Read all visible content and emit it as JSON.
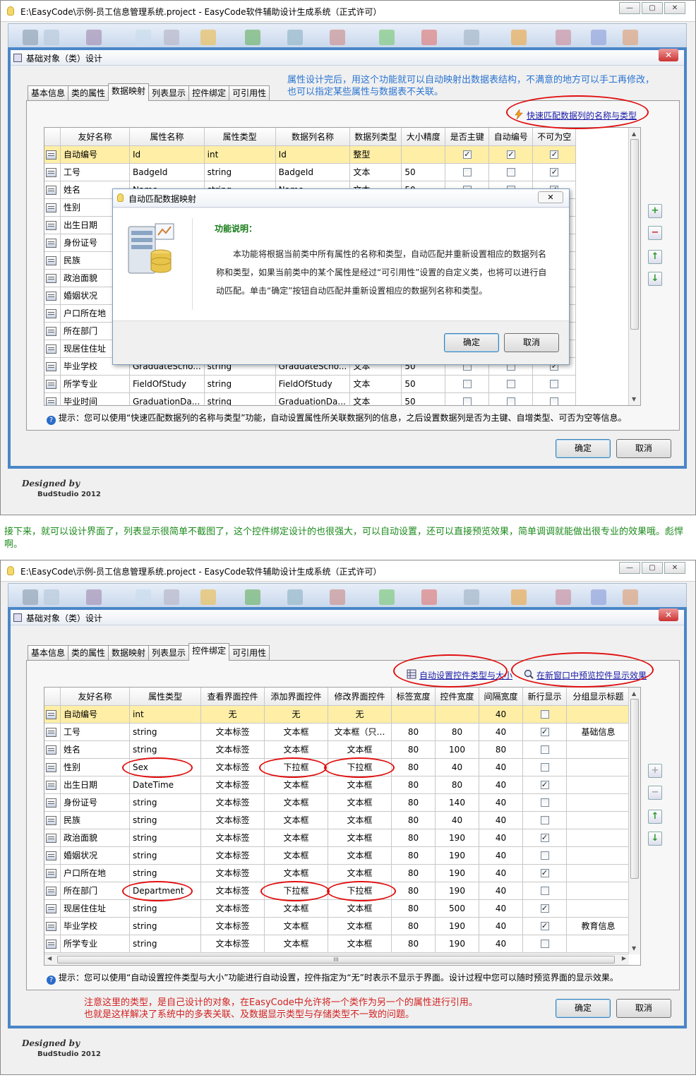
{
  "window_title": "E:\\EasyCode\\示例-员工信息管理系统.project - EasyCode软件辅助设计生成系统（正式许可）",
  "window_buttons": [
    "—",
    "▢",
    "✕"
  ],
  "dialog_title": "基础对象（类）设计",
  "close_glyph": "✕",
  "tabs": [
    "基本信息",
    "类的属性",
    "数据映射",
    "列表显示",
    "控件绑定",
    "可引用性"
  ],
  "ok_label": "确定",
  "cancel_label": "取消",
  "brand_line1": "Designed by",
  "brand_line2": "BudStudio 2012",
  "check_mark": "✓",
  "screen1": {
    "active_tab": "数据映射",
    "note_line1": "属性设计完后，用这个功能就可以自动映射出数据表结构，不满意的地方可以手工再修改，",
    "note_line2": "也可以指定某些属性与数据表不关联。",
    "link_auto_map": "快速匹配数据列的名称与类型",
    "columns": [
      "友好名称",
      "属性名称",
      "属性类型",
      "数据列名称",
      "数据列类型",
      "大小精度",
      "是否主键",
      "自动编号",
      "不可为空"
    ],
    "rows": [
      {
        "name": "自动编号",
        "prop": "Id",
        "type": "int",
        "col": "Id",
        "coltype": "整型",
        "size": "",
        "pk": true,
        "auto": true,
        "nn": true
      },
      {
        "name": "工号",
        "prop": "BadgeId",
        "type": "string",
        "col": "BadgeId",
        "coltype": "文本",
        "size": "50",
        "pk": false,
        "auto": false,
        "nn": true
      },
      {
        "name": "姓名",
        "prop": "Name",
        "type": "string",
        "col": "Name",
        "coltype": "文本",
        "size": "50",
        "pk": false,
        "auto": false,
        "nn": true
      },
      {
        "name": "性别"
      },
      {
        "name": "出生日期"
      },
      {
        "name": "身份证号"
      },
      {
        "name": "民族"
      },
      {
        "name": "政治面貌"
      },
      {
        "name": "婚姻状况"
      },
      {
        "name": "户口所在地"
      },
      {
        "name": "所在部门"
      },
      {
        "name": "现居住住址"
      },
      {
        "name": "毕业学校",
        "prop": "GraduateScho...",
        "type": "string",
        "col": "GraduateScho...",
        "coltype": "文本",
        "size": "50",
        "pk": false,
        "auto": false,
        "nn": true
      },
      {
        "name": "所学专业",
        "prop": "FieldOfStudy",
        "type": "string",
        "col": "FieldOfStudy",
        "coltype": "文本",
        "size": "50",
        "pk": false,
        "auto": false,
        "nn": false
      },
      {
        "name": "毕业时间",
        "prop": "GraduationDa...",
        "type": "string",
        "col": "GraduationDa...",
        "coltype": "文本",
        "size": "50",
        "pk": false,
        "auto": false,
        "nn": false
      }
    ],
    "hint": "提示：您可以使用“快速匹配数据列的名称与类型”功能，自动设置属性所关联数据列的信息，之后设置数据列是否为主键、自增类型、可否为空等信息。",
    "popup": {
      "title": "自动匹配数据映射",
      "heading": "功能说明：",
      "text": "本功能将根据当前类中所有属性的名称和类型，自动匹配并重新设置相应的数据列名称和类型，如果当前类中的某个属性是经过“可引用性”设置的自定义类，也将可以进行自动匹配。单击“确定”按钮自动匹配并重新设置相应的数据列名称和类型。",
      "ok": "确定",
      "cancel": "取消"
    }
  },
  "middle_text": "接下来，就可以设计界面了，列表显示很简单不截图了，这个控件绑定设计的也很强大，可以自动设置，还可以直接预览效果，简单调调就能做出很专业的效果哦。彪悍啊。",
  "screen2": {
    "active_tab": "控件绑定",
    "link_auto_set": "自动设置控件类型与大小",
    "link_preview": "在新窗口中预览控件显示效果",
    "columns": [
      "友好名称",
      "属性类型",
      "查看界面控件",
      "添加界面控件",
      "修改界面控件",
      "标签宽度",
      "控件宽度",
      "间隔宽度",
      "新行显示",
      "分组显示标题"
    ],
    "rows": [
      {
        "name": "自动编号",
        "type": "int",
        "view": "无",
        "add": "无",
        "edit": "无",
        "lw": "",
        "cw": "",
        "gap": "40",
        "nl": false,
        "group": ""
      },
      {
        "name": "工号",
        "type": "string",
        "view": "文本标签",
        "add": "文本框",
        "edit": "文本框（只…",
        "lw": "80",
        "cw": "80",
        "gap": "40",
        "nl": true,
        "group": "基础信息"
      },
      {
        "name": "姓名",
        "type": "string",
        "view": "文本标签",
        "add": "文本框",
        "edit": "文本框",
        "lw": "80",
        "cw": "100",
        "gap": "80",
        "nl": false,
        "group": ""
      },
      {
        "name": "性别",
        "type": "Sex",
        "view": "文本标签",
        "add": "下拉框",
        "edit": "下拉框",
        "lw": "80",
        "cw": "40",
        "gap": "40",
        "nl": false,
        "group": ""
      },
      {
        "name": "出生日期",
        "type": "DateTime",
        "view": "文本标签",
        "add": "文本框",
        "edit": "文本框",
        "lw": "80",
        "cw": "80",
        "gap": "40",
        "nl": true,
        "group": ""
      },
      {
        "name": "身份证号",
        "type": "string",
        "view": "文本标签",
        "add": "文本框",
        "edit": "文本框",
        "lw": "80",
        "cw": "140",
        "gap": "40",
        "nl": false,
        "group": ""
      },
      {
        "name": "民族",
        "type": "string",
        "view": "文本标签",
        "add": "文本框",
        "edit": "文本框",
        "lw": "80",
        "cw": "40",
        "gap": "40",
        "nl": false,
        "group": ""
      },
      {
        "name": "政治面貌",
        "type": "string",
        "view": "文本标签",
        "add": "文本框",
        "edit": "文本框",
        "lw": "80",
        "cw": "190",
        "gap": "40",
        "nl": true,
        "group": ""
      },
      {
        "name": "婚姻状况",
        "type": "string",
        "view": "文本标签",
        "add": "文本框",
        "edit": "文本框",
        "lw": "80",
        "cw": "190",
        "gap": "40",
        "nl": false,
        "group": ""
      },
      {
        "name": "户口所在地",
        "type": "string",
        "view": "文本标签",
        "add": "文本框",
        "edit": "文本框",
        "lw": "80",
        "cw": "190",
        "gap": "40",
        "nl": true,
        "group": ""
      },
      {
        "name": "所在部门",
        "type": "Department",
        "view": "文本标签",
        "add": "下拉框",
        "edit": "下拉框",
        "lw": "80",
        "cw": "190",
        "gap": "40",
        "nl": false,
        "group": ""
      },
      {
        "name": "现居住住址",
        "type": "string",
        "view": "文本标签",
        "add": "文本框",
        "edit": "文本框",
        "lw": "80",
        "cw": "500",
        "gap": "40",
        "nl": true,
        "group": ""
      },
      {
        "name": "毕业学校",
        "type": "string",
        "view": "文本标签",
        "add": "文本框",
        "edit": "文本框",
        "lw": "80",
        "cw": "190",
        "gap": "40",
        "nl": true,
        "group": "教育信息"
      },
      {
        "name": "所学专业",
        "type": "string",
        "view": "文本标签",
        "add": "文本框",
        "edit": "文本框",
        "lw": "80",
        "cw": "190",
        "gap": "40",
        "nl": false,
        "group": ""
      }
    ],
    "hscroll_grip": "III",
    "hint": "提示：您可以使用“自动设置控件类型与大小”功能进行自动设置，控件指定为“无”时表示不显示于界面。设计过程中您可以随时预览界面的显示效果。",
    "red_note_line1": "注意这里的类型，是自己设计的对象，在EasyCode中允许将一个类作为另一个的属性进行引用。",
    "red_note_line2": "也就是这样解决了系统中的多表关联、及数据显示类型与存储类型不一致的问题。"
  },
  "side_buttons": [
    "+",
    "−",
    "↑",
    "↓"
  ],
  "colors": {
    "accent_frame": "#4a86c8",
    "selected_row": "#ffeea6",
    "annotation_red": "#e01010",
    "note_blue": "#2a74d2",
    "para_green": "#1b8a1b"
  }
}
